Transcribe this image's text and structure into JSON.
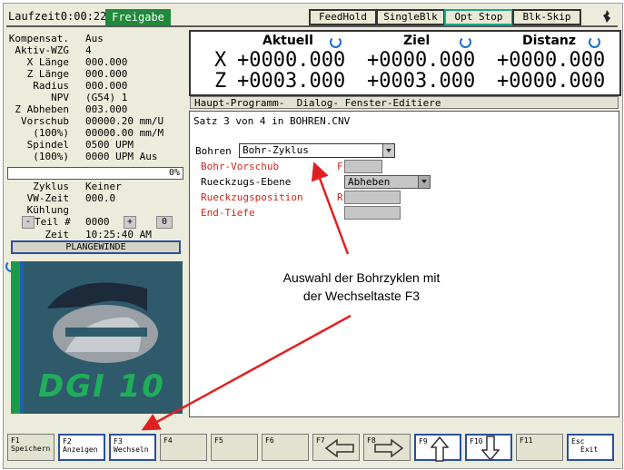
{
  "header": {
    "runtime": "Laufzeit0:00:22",
    "freigabe": "Freigabe",
    "buttons": [
      "FeedHold",
      "SingleBlk",
      "Opt Stop",
      "Blk-Skip"
    ]
  },
  "status": {
    "rows": [
      {
        "label": "Kompensat.",
        "value": "Aus"
      },
      {
        "label": "Aktiv-WZG",
        "value": "4"
      },
      {
        "label": "X Länge",
        "value": "000.000"
      },
      {
        "label": "Z Länge",
        "value": "000.000"
      },
      {
        "label": "Radius",
        "value": "000.000"
      },
      {
        "label": "NPV",
        "value": "(G54) 1"
      },
      {
        "label": "Z Abheben",
        "value": "003.000"
      },
      {
        "label": "Vorschub",
        "value": "00000.20 mm/U"
      },
      {
        "label": "(100%)",
        "value": "00000.00 mm/M"
      },
      {
        "label": "Spindel",
        "value": "0500 UPM"
      },
      {
        "label": "(100%)",
        "value": "0000 UPM Aus"
      }
    ],
    "progress_text": "0%",
    "progress_value": 0,
    "zyklus_label": "Zyklus",
    "zyklus_value": "Keiner",
    "vwzeit_label": "VW-Zeit",
    "vwzeit_value": "000.0",
    "kuehlung_label": "Kühlung",
    "teil_minus": "-",
    "teil_label": "Teil #",
    "teil_value": "0000",
    "teil_plus": "+",
    "teil_box": "0",
    "zeit_label": "Zeit",
    "zeit_value": "10:25:40 AM",
    "plangewinde": "PLANGEWINDE"
  },
  "dro": {
    "headers": [
      "Aktuell",
      "Ziel",
      "Distanz"
    ],
    "rows": [
      {
        "axis": "X",
        "aktuell": "+0000.000",
        "ziel": "+0000.000",
        "distanz": "+0000.000"
      },
      {
        "axis": "Z",
        "aktuell": "+0003.000",
        "ziel": "+0003.000",
        "distanz": "+0000.000"
      }
    ]
  },
  "tabs": "Haupt-Programm-  Dialog- Fenster-Editiere",
  "dialog": {
    "satz": "Satz 3 von 4 in BOHREN.CNV",
    "bohren_label": "Bohren",
    "bohren_value": "Bohr-Zyklus",
    "fields": [
      {
        "label": "Bohr-Vorschub",
        "prefix": "F",
        "kind": "input"
      },
      {
        "label": "Rueckzugs-Ebene",
        "prefix": "",
        "kind": "select",
        "value": "Abheben"
      },
      {
        "label": "Rueckzugsposition",
        "prefix": "R",
        "kind": "input"
      },
      {
        "label": "End-Tiefe",
        "prefix": "",
        "kind": "input"
      }
    ]
  },
  "logo_text": "DGI 10",
  "annotation": {
    "line1": "Auswahl der Bohrzyklen mit",
    "line2": "der Wechseltaste F3"
  },
  "fkeys": [
    {
      "key": "F1",
      "label": "Speichern"
    },
    {
      "key": "F2",
      "label": "Anzeigen"
    },
    {
      "key": "F3",
      "label": "Wechseln"
    },
    {
      "key": "F4",
      "label": ""
    },
    {
      "key": "F5",
      "label": ""
    },
    {
      "key": "F6",
      "label": ""
    },
    {
      "key": "F7",
      "label": ""
    },
    {
      "key": "F8",
      "label": ""
    },
    {
      "key": "F9",
      "label": ""
    },
    {
      "key": "F10",
      "label": ""
    },
    {
      "key": "F11",
      "label": ""
    },
    {
      "key": "Esc",
      "label": "Exit"
    }
  ],
  "colors": {
    "accent_green": "#1f8a3a",
    "accent_blue": "#1a6fd0",
    "arrow_red": "#e02020",
    "label_red": "#cc2a1a"
  }
}
